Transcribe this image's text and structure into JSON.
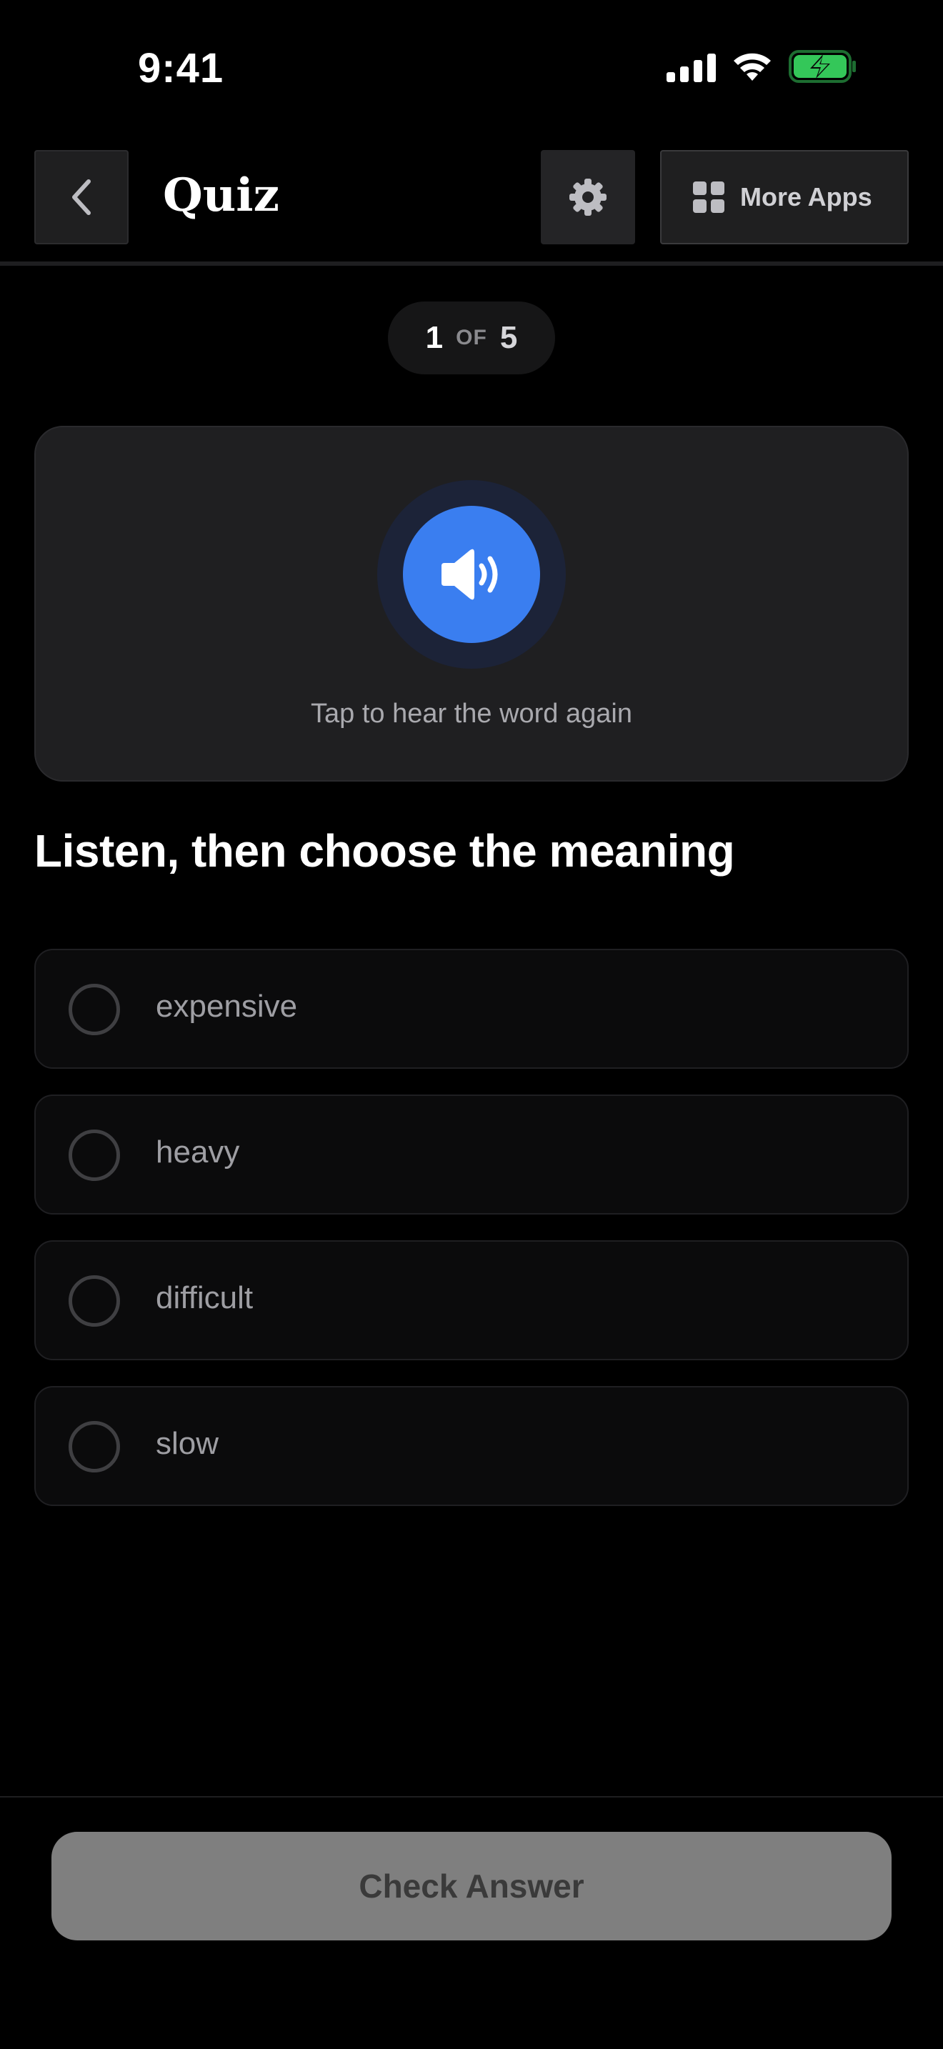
{
  "status_bar": {
    "time": "9:41",
    "icons": [
      "signal-icon",
      "wifi-icon",
      "battery-charging-icon"
    ],
    "battery_color": "#34c759"
  },
  "header": {
    "title": "Quiz",
    "more_apps_label": "More Apps",
    "icons": [
      "chevron-left-icon",
      "gear-icon",
      "grid-icon"
    ]
  },
  "progress": {
    "current": "1",
    "separator": "OF",
    "total": "5"
  },
  "audio_card": {
    "hint": "Tap to hear the word again",
    "icon": "speaker-icon",
    "accent": "#3a7ef0"
  },
  "question": {
    "title": "Listen, then choose the meaning"
  },
  "options": [
    {
      "label": "expensive"
    },
    {
      "label": "heavy"
    },
    {
      "label": "difficult"
    },
    {
      "label": "slow"
    }
  ],
  "footer": {
    "check_label": "Check Answer"
  }
}
